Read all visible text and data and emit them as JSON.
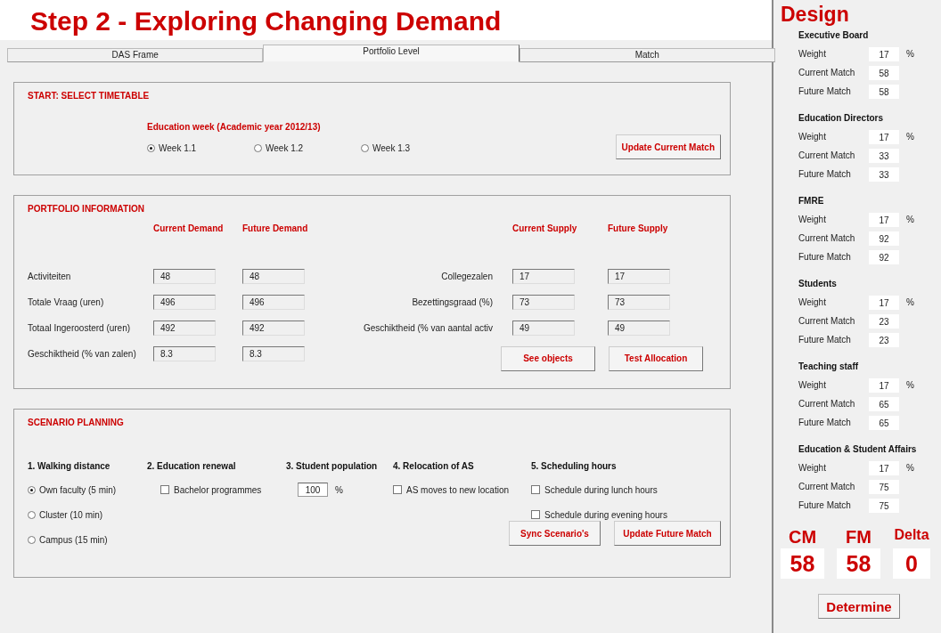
{
  "title": "Step 2 - Exploring Changing Demand",
  "tabs": [
    {
      "label": "DAS Frame",
      "selected": false
    },
    {
      "label": "Portfolio Level",
      "selected": true
    },
    {
      "label": "Match",
      "selected": false
    }
  ],
  "timetable": {
    "heading": "START: SELECT TIMETABLE",
    "subheading": "Education week (Academic year 2012/13)",
    "options": [
      {
        "label": "Week 1.1",
        "selected": true
      },
      {
        "label": "Week 1.2",
        "selected": false
      },
      {
        "label": "Week 1.3",
        "selected": false
      }
    ],
    "button": "Update Current Match"
  },
  "portfolio": {
    "heading": "PORTFOLIO INFORMATION",
    "demand_headers": [
      "Current Demand",
      "Future Demand"
    ],
    "supply_headers": [
      "Current Supply",
      "Future Supply"
    ],
    "demand_rows": [
      {
        "label": "Activiteiten",
        "current": "48",
        "future": "48"
      },
      {
        "label": "Totale Vraag (uren)",
        "current": "496",
        "future": "496"
      },
      {
        "label": "Totaal Ingeroosterd (uren)",
        "current": "492",
        "future": "492"
      },
      {
        "label": "Geschiktheid (% van zalen)",
        "current": "8.3",
        "future": "8.3"
      }
    ],
    "supply_rows": [
      {
        "label": "Collegezalen",
        "current": "17",
        "future": "17"
      },
      {
        "label": "Bezettingsgraad (%)",
        "current": "73",
        "future": "73"
      },
      {
        "label": "Geschiktheid (% van aantal activ",
        "current": "49",
        "future": "49"
      }
    ],
    "buttons": [
      "See objects",
      "Test Allocation"
    ]
  },
  "scenario": {
    "heading": "SCENARIO PLANNING",
    "groups": [
      {
        "title": "1. Walking distance",
        "items": [
          {
            "kind": "radio",
            "label": "Own faculty (5 min)",
            "selected": true
          },
          {
            "kind": "radio",
            "label": "Cluster (10 min)",
            "selected": false
          },
          {
            "kind": "radio",
            "label": "Campus (15 min)",
            "selected": false
          }
        ]
      },
      {
        "title": "2. Education renewal",
        "items": [
          {
            "kind": "checkbox",
            "label": "Bachelor programmes",
            "checked": false
          }
        ]
      },
      {
        "title": "3. Student population",
        "items": [
          {
            "kind": "number",
            "value": "100",
            "unit": "%"
          }
        ]
      },
      {
        "title": "4. Relocation of AS",
        "items": [
          {
            "kind": "checkbox",
            "label": "AS moves to new location",
            "checked": false
          }
        ]
      },
      {
        "title": "5. Scheduling hours",
        "items": [
          {
            "kind": "checkbox",
            "label": "Schedule during lunch hours",
            "checked": false
          },
          {
            "kind": "checkbox",
            "label": "Schedule during evening hours",
            "checked": false
          }
        ]
      }
    ],
    "buttons": [
      "Sync Scenario's",
      "Update Future Match"
    ]
  },
  "design": {
    "title": "Design",
    "groups": [
      {
        "name": "Executive Board",
        "rows": [
          {
            "label": "Weight",
            "value": "17",
            "unit": "%"
          },
          {
            "label": "Current Match",
            "value": "58"
          },
          {
            "label": "Future Match",
            "value": "58"
          }
        ]
      },
      {
        "name": "Education Directors",
        "rows": [
          {
            "label": "Weight",
            "value": "17",
            "unit": "%"
          },
          {
            "label": "Current Match",
            "value": "33"
          },
          {
            "label": "Future Match",
            "value": "33"
          }
        ]
      },
      {
        "name": "FMRE",
        "rows": [
          {
            "label": "Weight",
            "value": "17",
            "unit": "%"
          },
          {
            "label": "Current Match",
            "value": "92"
          },
          {
            "label": "Future Match",
            "value": "92"
          }
        ]
      },
      {
        "name": "Students",
        "rows": [
          {
            "label": "Weight",
            "value": "17",
            "unit": "%"
          },
          {
            "label": "Current Match",
            "value": "23"
          },
          {
            "label": "Future Match",
            "value": "23"
          }
        ]
      },
      {
        "name": "Teaching staff",
        "rows": [
          {
            "label": "Weight",
            "value": "17",
            "unit": "%"
          },
          {
            "label": "Current Match",
            "value": "65"
          },
          {
            "label": "Future Match",
            "value": "65"
          }
        ]
      },
      {
        "name": "Education & Student Affairs",
        "rows": [
          {
            "label": "Weight",
            "value": "17",
            "unit": "%"
          },
          {
            "label": "Current Match",
            "value": "75"
          },
          {
            "label": "Future Match",
            "value": "75"
          }
        ]
      }
    ],
    "totals": [
      {
        "label": "CM",
        "value": "58"
      },
      {
        "label": "FM",
        "value": "58"
      },
      {
        "label": "Delta",
        "value": "0"
      }
    ],
    "button": "Determine"
  }
}
